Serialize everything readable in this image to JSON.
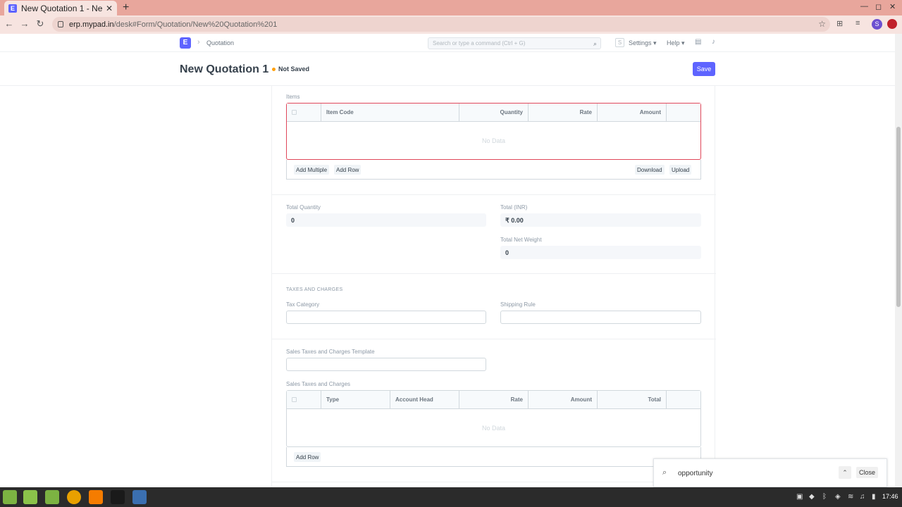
{
  "browser": {
    "tab_title": "New Quotation 1 - Ne",
    "tab_favicon": "E",
    "tab_close": "✕",
    "new_tab": "+",
    "url_host": "erp.mypad.in",
    "url_path": "/desk#Form/Quotation/New%20Quotation%201",
    "profile_initial": "S"
  },
  "navbar": {
    "app_logo": "E",
    "breadcrumb": "Quotation",
    "search_placeholder": "Search or type a command (Ctrl + G)",
    "user_initial": "S",
    "settings_label": "Settings",
    "help_label": "Help"
  },
  "page": {
    "title": "New Quotation 1",
    "status": "Not Saved",
    "save_label": "Save"
  },
  "items": {
    "section_label": "Items",
    "columns": [
      "Item Code",
      "Quantity",
      "Rate",
      "Amount"
    ],
    "empty_text": "No Data",
    "add_multiple_label": "Add Multiple",
    "add_row_label": "Add Row",
    "download_label": "Download",
    "upload_label": "Upload"
  },
  "totals": {
    "total_quantity_label": "Total Quantity",
    "total_quantity_value": "0",
    "total_label": "Total (INR)",
    "total_value": "₹ 0.00",
    "net_weight_label": "Total Net Weight",
    "net_weight_value": "0"
  },
  "taxes": {
    "section_title": "TAXES AND CHARGES",
    "tax_category_label": "Tax Category",
    "shipping_rule_label": "Shipping Rule",
    "template_label": "Sales Taxes and Charges Template",
    "table_label": "Sales Taxes and Charges",
    "columns": [
      "Type",
      "Account Head",
      "Rate",
      "Amount",
      "Total"
    ],
    "empty_text": "No Data",
    "add_row_label": "Add Row"
  },
  "findbar": {
    "query": "opportunity",
    "close_label": "Close"
  },
  "taskbar": {
    "clock": "17:46"
  },
  "colors": {
    "primary": "#5e64ff",
    "not_saved_dot": "#ffa00a",
    "required_grid_border": "#e0475a",
    "tab_strip": "#e8a69c"
  }
}
